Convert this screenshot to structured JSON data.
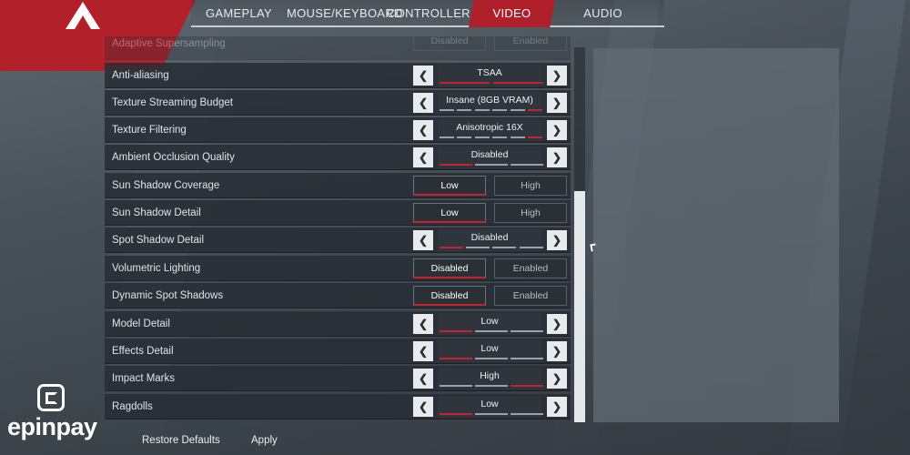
{
  "nav": {
    "tabs": [
      {
        "label": "GAMEPLAY"
      },
      {
        "label": "MOUSE/KEYBOARD"
      },
      {
        "label": "CONTROLLER"
      },
      {
        "label": "VIDEO",
        "active": true
      },
      {
        "label": "AUDIO"
      }
    ]
  },
  "settings": {
    "partial_row": {
      "label": "Adaptive Supersampling",
      "options": [
        "Disabled",
        "Enabled"
      ]
    },
    "rows": [
      {
        "label": "Anti-aliasing",
        "control": "selector",
        "value": "TSAA",
        "segments": 2,
        "level": 2
      },
      {
        "label": "Texture Streaming Budget",
        "control": "selector",
        "value": "Insane (8GB VRAM)",
        "segments": 6,
        "level": 6
      },
      {
        "label": "Texture Filtering",
        "control": "selector",
        "value": "Anisotropic 16X",
        "segments": 6,
        "level": 6
      },
      {
        "label": "Ambient Occlusion Quality",
        "control": "selector",
        "value": "Disabled",
        "segments": 3,
        "level": 1
      },
      {
        "label": "Sun Shadow Coverage",
        "control": "toggle",
        "options": [
          "Low",
          "High"
        ],
        "selected": 0
      },
      {
        "label": "Sun Shadow Detail",
        "control": "toggle",
        "options": [
          "Low",
          "High"
        ],
        "selected": 0
      },
      {
        "label": "Spot Shadow Detail",
        "control": "selector",
        "value": "Disabled",
        "segments": 4,
        "level": 1
      },
      {
        "label": "Volumetric Lighting",
        "control": "toggle",
        "options": [
          "Disabled",
          "Enabled"
        ],
        "selected": 0
      },
      {
        "label": "Dynamic Spot Shadows",
        "control": "toggle",
        "options": [
          "Disabled",
          "Enabled"
        ],
        "selected": 0
      },
      {
        "label": "Model Detail",
        "control": "selector",
        "value": "Low",
        "segments": 3,
        "level": 1
      },
      {
        "label": "Effects Detail",
        "control": "selector",
        "value": "Low",
        "segments": 3,
        "level": 1
      },
      {
        "label": "Impact Marks",
        "control": "selector",
        "value": "High",
        "segments": 3,
        "level": 3
      },
      {
        "label": "Ragdolls",
        "control": "selector",
        "value": "Low",
        "segments": 3,
        "level": 1
      }
    ]
  },
  "icons": {
    "prev": "chevron-left-icon",
    "next": "chevron-right-icon"
  },
  "footer": {
    "restore_label": "Restore Defaults",
    "apply_label": "Apply"
  },
  "watermark": {
    "text": "epinpay"
  },
  "colors": {
    "accent": "#b0202a",
    "panel": "#2c3238"
  }
}
